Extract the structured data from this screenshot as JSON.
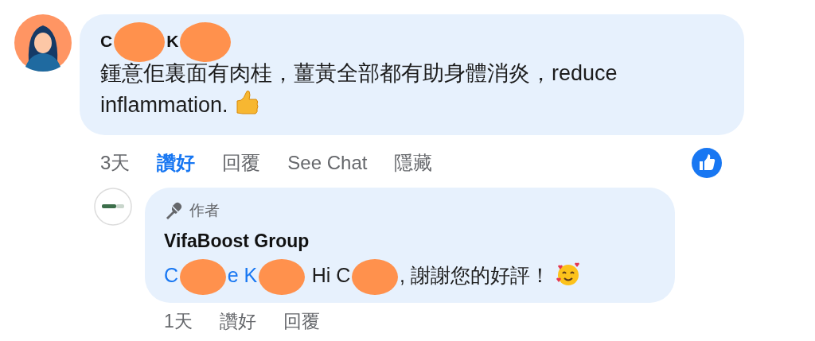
{
  "comment": {
    "author_parts": [
      {
        "kind": "text",
        "text": "C"
      },
      {
        "kind": "redacted"
      },
      {
        "kind": "text",
        "text": "K"
      },
      {
        "kind": "redacted"
      }
    ],
    "body": "鍾意佢裏面有肉桂，薑黃全部都有助身體消炎，reduce inflammation.",
    "time": "3天",
    "actions": [
      {
        "label": "讚好",
        "selected": true
      },
      {
        "label": "回覆",
        "selected": false
      },
      {
        "label": "See Chat",
        "selected": false
      },
      {
        "label": "隱藏",
        "selected": false
      }
    ]
  },
  "reply": {
    "badge": "作者",
    "author": "VifaBoost Group",
    "body_parts": [
      {
        "kind": "mention",
        "text": "C"
      },
      {
        "kind": "redacted"
      },
      {
        "kind": "mention",
        "text": "e K"
      },
      {
        "kind": "redacted"
      },
      {
        "kind": "text",
        "text": " Hi C"
      },
      {
        "kind": "redacted"
      },
      {
        "kind": "text",
        "text": ", 謝謝您的好評！"
      }
    ],
    "time": "1天",
    "actions": [
      {
        "label": "讚好",
        "selected": false
      },
      {
        "label": "回覆",
        "selected": false
      }
    ]
  }
}
